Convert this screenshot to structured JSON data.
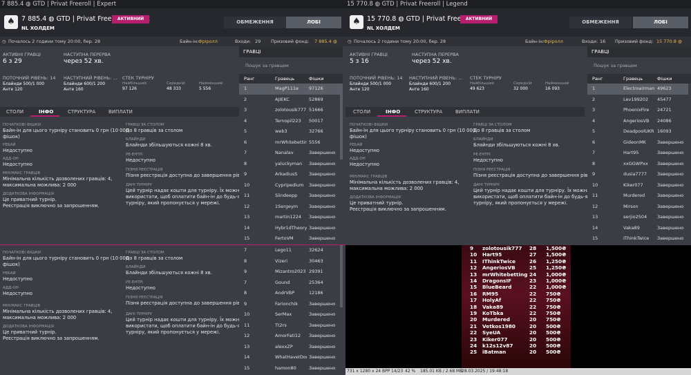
{
  "left": {
    "title": "7 885.4 ◍ GTD | Privat Freeroll | Expert",
    "name": "7 885.4 ◍ GTD | Privat Freeroll | Expert",
    "game": "NL ХОЛДЕМ",
    "badge": "АКТИВНИЙ",
    "limits_btn": "ОБМЕЖЕННЯ",
    "lobby_btn": "ЛОБІ",
    "started": "Почалось 2 години тому 20:00, бер. 28",
    "buyin_label": "Байн-ін:",
    "buyin_value": "Фріролл",
    "entries_label": "Входи:",
    "entries_value": "29",
    "prize_label": "Призовий фонд:",
    "prize_value": "7 885.4 ◍",
    "active_label": "АКТИВНІ ГРАВЦІ",
    "active_value": "6 з 29",
    "break_label": "НАСТУПНА ПЕРЕРВА",
    "break_value": "через 52 хв.",
    "cur_level_label": "ПОТОЧНИЙ РІВЕНЬ: 14",
    "cur_blinds": "Блайнди 500/1 000",
    "cur_ante": "Анте 120",
    "next_level_label": "НАСТУПНИЙ РІВЕНЬ: ...",
    "next_blinds": "Блайнди 600/1 200",
    "next_ante": "Анте 160",
    "stack_label": "СТЕК ТУРНІРУ",
    "stack_max_label": "Найбільший",
    "stack_max": "97 126",
    "stack_avg_label": "Середній",
    "stack_avg": "48 333",
    "stack_min_label": "Найменший",
    "stack_min": "5 556",
    "players_title": "ГРАВЦІ",
    "search_placeholder": "Пошук за гравцем",
    "col_rank": "Ранг",
    "col_player": "Гравець",
    "col_chips": "Фішки",
    "rows": [
      [
        "1",
        "MagP111e",
        "97126"
      ],
      [
        "2",
        "AJIEKC",
        "52869"
      ],
      [
        "3",
        "zolotousik777",
        "51666"
      ],
      [
        "4",
        "Ternopil223",
        "50017"
      ],
      [
        "5",
        "web3",
        "32766"
      ],
      [
        "6",
        "mrWhitebetting",
        "5556"
      ],
      [
        "7",
        "Nanalav",
        "Завершено"
      ],
      [
        "8",
        "yaluckyman",
        "Завершено"
      ],
      [
        "9",
        "ArkadiusS",
        "Завершено"
      ],
      [
        "10",
        "Cypripedium",
        "Завершено"
      ],
      [
        "11",
        "Siindeepp",
        "Завершено"
      ],
      [
        "12",
        "1Sergeym",
        "Завершено"
      ],
      [
        "13",
        "martin1224",
        "Завершено"
      ],
      [
        "14",
        "Hybr1dTheory",
        "Завершено"
      ],
      [
        "15",
        "FertoVM",
        "Завершено"
      ]
    ]
  },
  "right": {
    "title": "15 770.8 ◍ GTD | Privat Freeroll | Legend",
    "name": "15 770.8 ◍ GTD | Privat Free...",
    "game": "NL ХОЛДЕМ",
    "badge": "АКТИВНИЙ",
    "limits_btn": "ОБМЕЖЕННЯ",
    "lobby_btn": "ЛОБІ",
    "started": "Почалось 2 години тому 20:00, бер. 28",
    "buyin_label": "Байн-ін:",
    "buyin_value": "Фріролл",
    "entries_label": "Входи:",
    "entries_value": "16",
    "prize_label": "Призовий фонд:",
    "prize_value": "15 770.8 ◍",
    "active_label": "АКТИВНІ ГРАВЦІ",
    "active_value": "5 з 16",
    "break_label": "НАСТУПНА ПЕРЕРВА",
    "break_value": "через 52 хв.",
    "cur_level_label": "ПОТОЧНИЙ РІВЕНЬ: 14",
    "cur_blinds": "Блайнди 500/1 000",
    "cur_ante": "Анте 120",
    "next_level_label": "НАСТУПНИЙ РІВЕНЬ: ...",
    "next_blinds": "Блайнди 600/1 200",
    "next_ante": "Анте 160",
    "stack_label": "СТЕК ТУРНІРУ",
    "stack_max_label": "Найбільший",
    "stack_max": "49 623",
    "stack_avg_label": "Середній",
    "stack_avg": "32 000",
    "stack_min_label": "Найменший",
    "stack_min": "16 093",
    "players_title": "ГРАВЦІ",
    "search_placeholder": "Пошук за гравцем",
    "col_rank": "Ранг",
    "col_player": "Гравець",
    "col_chips": "Фішки",
    "rows": [
      [
        "1",
        "Electroairman",
        "49623"
      ],
      [
        "2",
        "Lev199202",
        "45477"
      ],
      [
        "3",
        "PhoenixFire",
        "24721"
      ],
      [
        "4",
        "AngeriosVB",
        "24086"
      ],
      [
        "5",
        "DeadpoolUKR",
        "16093"
      ],
      [
        "6",
        "GideonMK",
        "Завершено"
      ],
      [
        "7",
        "Hart95",
        "Завершено"
      ],
      [
        "8",
        "xxGGWPxx",
        "Завершено"
      ],
      [
        "9",
        "dusia7777",
        "Завершено"
      ],
      [
        "10",
        "Kiker077",
        "Завершено"
      ],
      [
        "11",
        "Murdered",
        "Завершено"
      ],
      [
        "12",
        "Mirson",
        "Завершено"
      ],
      [
        "13",
        "serjio2504",
        "Завершено"
      ],
      [
        "14",
        "Vaka89",
        "Завершено"
      ],
      [
        "15",
        "IThinkTwice",
        "Завершено"
      ]
    ]
  },
  "tabs": [
    "СТОЛИ",
    "ІНФО",
    "СТРУКТУРА",
    "ВИПЛАТИ"
  ],
  "info": {
    "chips_h": "ПОЧАТКОВІ ФІШКИ",
    "chips_t1": "Байн-ін для цього турніру становить 0 грн (10 000",
    "chips_t2": "фішок)",
    "rebuy_h": "РЕБАЙ",
    "rebuy_t": "Недоступно",
    "addon_h": "АДД-ОН",
    "addon_t": "Недоступно",
    "minmax_h": "МІН/МАКС ГРАВЦІВ",
    "minmax_t1": "Мінімальна кількість дозволених гравців: 4,",
    "minmax_t2": "максимальна можлива: 2 000",
    "extra_h": "ДОДАТКОВА ІНФОРМАЦІЯ",
    "extra_t1": "Це приватний турнір.",
    "extra_t2": "Реєстрація виключно за запрошенням.",
    "table_h": "ГРАВЦІ ЗА СТОЛОМ",
    "table_t": "До 8 гравців за столом",
    "blinds_h": "БЛАЙНДИ",
    "blinds_t": "Блайнди збільшуються кожні 8 хв.",
    "reentry_h": "РЕ-ЕНТРІ",
    "reentry_t": "Недоступно",
    "latereg_h": "ПІЗНЯ РЕЄСТРАЦІЯ",
    "latereg_t": "Пізня реєстрація доступна до завершення рівня 2",
    "this_h": "ДАНІ ТУРНІРУ",
    "this_t1": "Цей турнір надає кошти для турніру. Їх можна",
    "this_t2": "використати, щоб оплатити байн-ін до будь-якого",
    "this_t3": "турніру, який пропонується у мережі."
  },
  "bottom_rows": [
    [
      "7",
      "Lego11",
      "32624"
    ],
    [
      "8",
      "Vizeri",
      "30463"
    ],
    [
      "9",
      "Mizantro2023",
      "29391"
    ],
    [
      "7",
      "Gound",
      "25364"
    ],
    [
      "8",
      "AndrVBP",
      "12186"
    ],
    [
      "9",
      "Farionchik",
      "Завершено"
    ],
    [
      "10",
      "SerMax",
      "Завершено"
    ],
    [
      "11",
      "Tt2rs",
      "Завершено"
    ],
    [
      "12",
      "AmorFati12",
      "Завершено"
    ],
    [
      "13",
      "alexxZP",
      "Завершено"
    ],
    [
      "14",
      "WhatHaveIDone",
      "Завершено"
    ],
    [
      "15",
      "hamon80",
      "Завершено"
    ]
  ],
  "results": [
    [
      "9",
      "zolotousik777",
      "28",
      "1,500₴"
    ],
    [
      "10",
      "Hart95",
      "27",
      "1,500₴"
    ],
    [
      "11",
      "IThinkTwice",
      "26",
      "1,250₴"
    ],
    [
      "12",
      "AngeriosVB",
      "25",
      "1,250₴"
    ],
    [
      "13",
      "mrWhitebetting",
      "24",
      "1,000₴"
    ],
    [
      "14",
      "DragonsIF",
      "23",
      "1,000₴"
    ],
    [
      "15",
      "BlueBeard",
      "22",
      "1,000₴"
    ],
    [
      "16",
      "RM95",
      "22",
      "750₴"
    ],
    [
      "17",
      "HolyAf",
      "22",
      "750₴"
    ],
    [
      "18",
      "Vaka89",
      "22",
      "750₴"
    ],
    [
      "19",
      "KoTbka",
      "22",
      "750₴"
    ],
    [
      "20",
      "Murdered",
      "20",
      "750₴"
    ],
    [
      "21",
      "Vetkos1980",
      "20",
      "500₴"
    ],
    [
      "22",
      "SyeUA",
      "20",
      "500₴"
    ],
    [
      "23",
      "Kiker077",
      "20",
      "500₴"
    ],
    [
      "24",
      "k12s12v87",
      "20",
      "500₴"
    ],
    [
      "25",
      "iBatman",
      "20",
      "500₴"
    ]
  ],
  "status": {
    "dims": "731 x 1280 x 24 BPP",
    "page": "14/23",
    "zoom": "42 %",
    "size": "185.01 KB / 2.68 MB",
    "date": "28.03.2025 / 19:48:18"
  },
  "colors": {
    "accent": "#b81e6e",
    "gold": "#e8b84a",
    "active": "#e0508f"
  }
}
